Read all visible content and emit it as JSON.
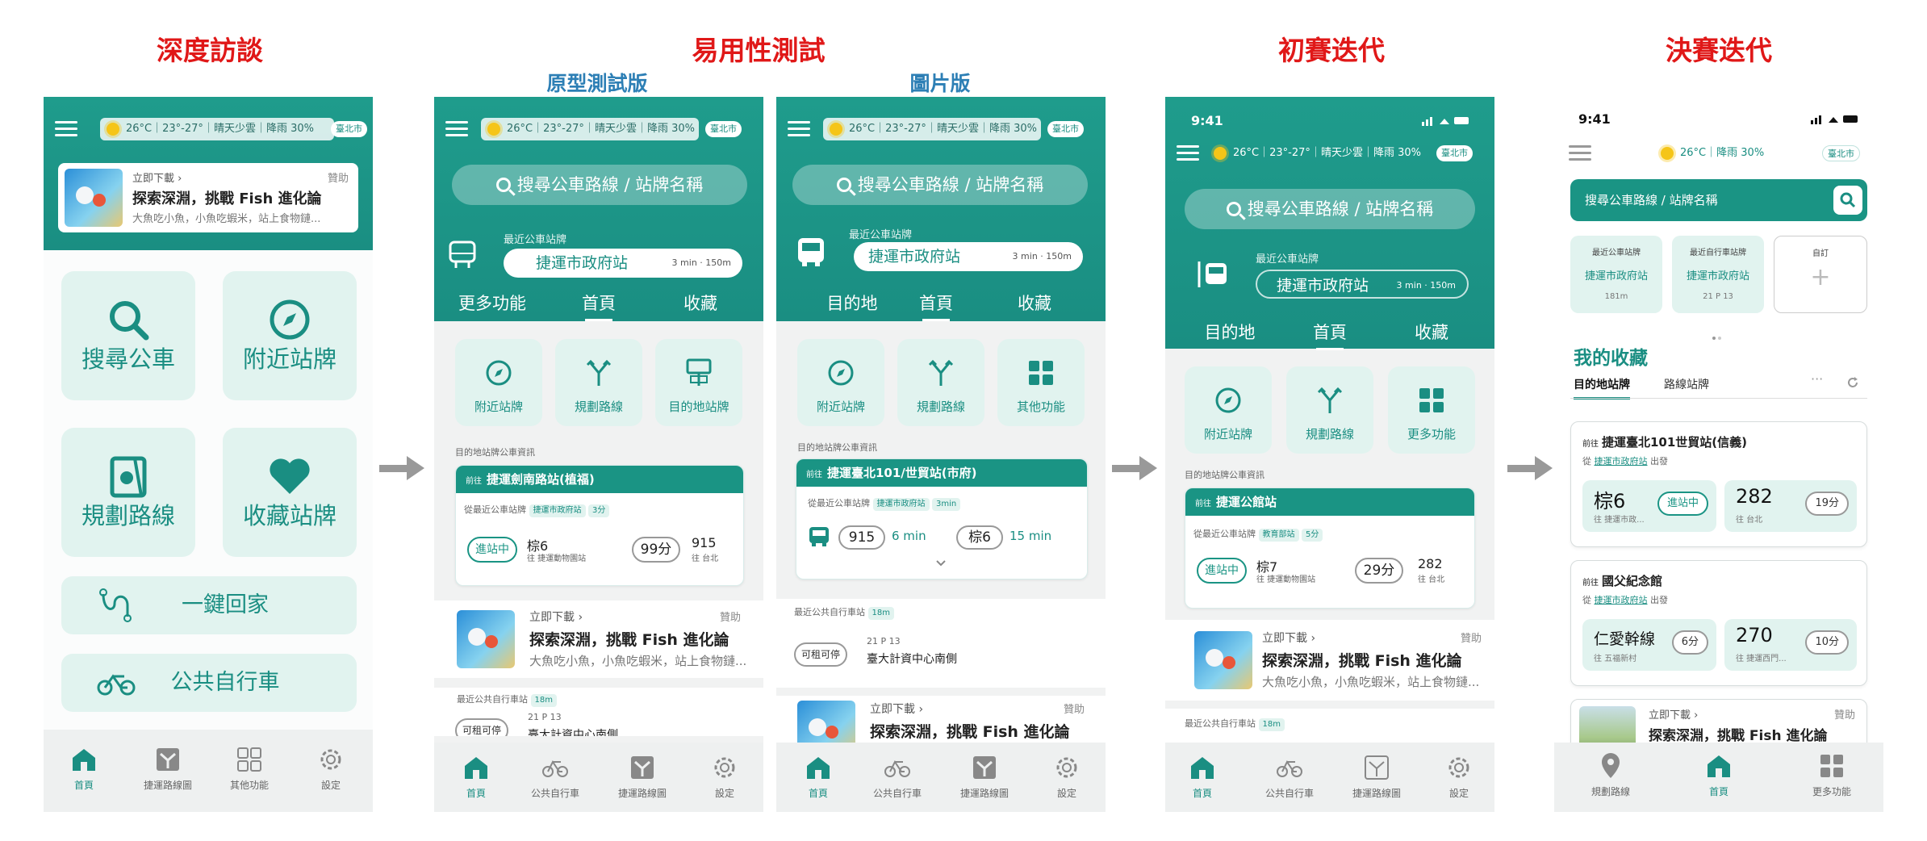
{
  "stages": {
    "interview": "深度訪談",
    "usability": "易用性測試",
    "prototype": "原型測試版",
    "image": "圖片版",
    "prelim": "初賽迭代",
    "final": "決賽迭代"
  },
  "weather": {
    "temp": "26°C",
    "range": "23°-27°",
    "cond": "晴天少雲",
    "rain": "降雨 30%",
    "city": "臺北市",
    "status_time": "9:41"
  },
  "search_placeholder": "搜尋公車路線 / 站牌名稱",
  "nearest": {
    "label": "最近公車站牌",
    "station": "捷運市政府站",
    "walk": "3 min · 150m"
  },
  "tabs": {
    "more": "更多功能",
    "home": "首頁",
    "fav": "收藏",
    "dest": "目的地"
  },
  "p1": {
    "ad_dl": "立即下載 ›",
    "ad_sponsor": "贊助",
    "ad_title": "探索深淵，挑戰 Fish 進化論",
    "ad_desc": "大魚吃小魚，小魚吃蝦米，站上食物鏈...",
    "btn_search": "搜尋公車",
    "btn_nearby": "附近站牌",
    "btn_plan": "規劃路線",
    "btn_fav": "收藏站牌",
    "btn_home": "一鍵回家",
    "btn_bike": "公共自行車",
    "nav": [
      "首頁",
      "捷運路線圖",
      "其他功能",
      "設定"
    ]
  },
  "p2": {
    "grid": [
      "附近站牌",
      "規劃路線",
      "目的地站牌"
    ],
    "dest_info": "目的地站牌公車資訊",
    "card_to": "前往",
    "card_station": "捷運劍南路站(植福)",
    "from_label": "從最近公車站牌",
    "from_station": "捷運市政府站",
    "from_walk": "3分",
    "status": "進站中",
    "route1": "棕6",
    "route1_sub": "往 捷運動物園站",
    "mins": "99分",
    "route2": "915",
    "route2_sub": "往 台北",
    "bike_label": "最近公共自行車站",
    "bike_dist": "18m",
    "bike_status": "可租可停",
    "bike_counts": "21   P 13",
    "bike_station": "臺大計資中心南側",
    "nav": [
      "首頁",
      "公共自行車",
      "捷運路線圖",
      "設定"
    ]
  },
  "p3": {
    "grid": [
      "附近站牌",
      "規劃路線",
      "其他功能"
    ],
    "dest_info": "目的地站牌公車資訊",
    "card_station": "捷運臺北101/世貿站(市府)",
    "from_label": "從最近公車站牌",
    "from_station": "捷運市政府站",
    "from_walk": "3min",
    "bus1": "915",
    "bus1_min": "6 min",
    "bus2": "棕6",
    "bus2_min": "15 min"
  },
  "p4": {
    "grid": [
      "附近站牌",
      "規劃路線",
      "更多功能"
    ],
    "card_station": "捷運公館站",
    "from_station": "教育部站",
    "from_walk": "5分",
    "route1": "棕7",
    "mins": "29分",
    "route2": "282"
  },
  "p5": {
    "search": "搜尋公車路線 / 站牌名稱",
    "q1_label": "最近公車站牌",
    "q1_station": "捷運市政府站",
    "q1_dist": "181m",
    "q2_label": "最近自行車站牌",
    "q2_station": "捷運市政府站",
    "q2_counts": "21   P 13",
    "q3_label": "自訂",
    "fav_title": "我的收藏",
    "fav_tab1": "目的地站牌",
    "fav_tab2": "路線站牌",
    "fav1_station": "捷運臺北101世貿站(信義)",
    "from": "從",
    "from_station": "捷運市政府站",
    "depart": "出發",
    "fav1_r1": "棕6",
    "fav1_r1_sub": "往 捷運市政...",
    "fav1_r1_status": "進站中",
    "fav1_r2": "282",
    "fav1_r2_sub": "往 台北",
    "fav1_r2_min": "19分",
    "fav2_station": "國父紀念館",
    "fav2_r1": "仁愛幹線",
    "fav2_r1_sub": "往 五福新村",
    "fav2_r1_min": "6分",
    "fav2_r2": "270",
    "fav2_r2_sub": "往 捷運西門...",
    "fav2_r2_min": "10分",
    "nav": [
      "規劃路線",
      "首頁",
      "更多功能"
    ]
  },
  "colors": {
    "title_red": "#e01818",
    "subtitle_blue": "#2d7fb5",
    "teal": "#1a8e82",
    "light_teal": "#e1f3ef"
  }
}
